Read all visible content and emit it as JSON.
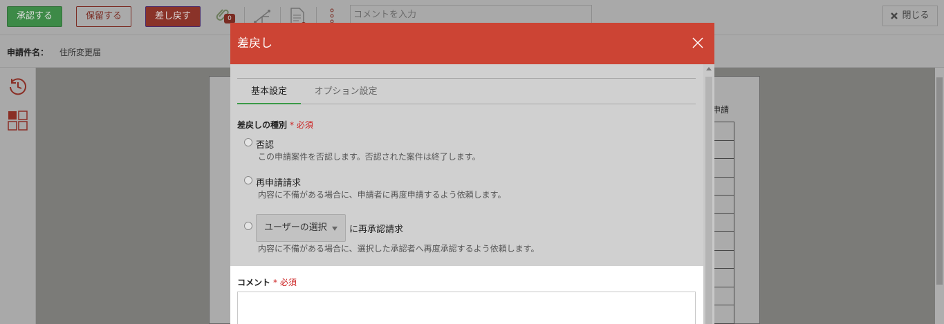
{
  "toolbar": {
    "approve_label": "承認する",
    "hold_label": "保留する",
    "return_label": "差し戻す",
    "attachment_count": "0",
    "comment_placeholder": "コメントを入力",
    "close_label": "閉じる",
    "icons": [
      "paperclip-icon",
      "route-icon",
      "document-icon",
      "more-vertical-icon",
      "close-x-icon"
    ]
  },
  "request": {
    "name_label": "申請件名：",
    "name_value": "住所変更届"
  },
  "sidebar": {
    "icons": [
      "history-clock-icon",
      "layout-grid-icon"
    ]
  },
  "document": {
    "partial_text": "申請"
  },
  "modal": {
    "title": "差戻し",
    "tabs": [
      {
        "label": "基本設定",
        "active": true
      },
      {
        "label": "オプション設定",
        "active": false
      }
    ],
    "type_label": "差戻しの種別",
    "required_mark": "* 必須",
    "options": [
      {
        "label": "否認",
        "desc": "この申請案件を否認します。否認された案件は終了します。"
      },
      {
        "label": "再申請請求",
        "desc": "内容に不備がある場合に、申請者に再度申請するよう依頼します。"
      },
      {
        "label": "に再承認請求",
        "desc": "内容に不備がある場合に、選択した承認者へ再度承認するよう依頼します。",
        "select_value": "ユーザーの選択"
      }
    ],
    "comment_label": "コメント"
  },
  "colors": {
    "header_red": "#cc4434",
    "active_tab_green": "#3a9a47",
    "required_red": "#cc2222"
  }
}
